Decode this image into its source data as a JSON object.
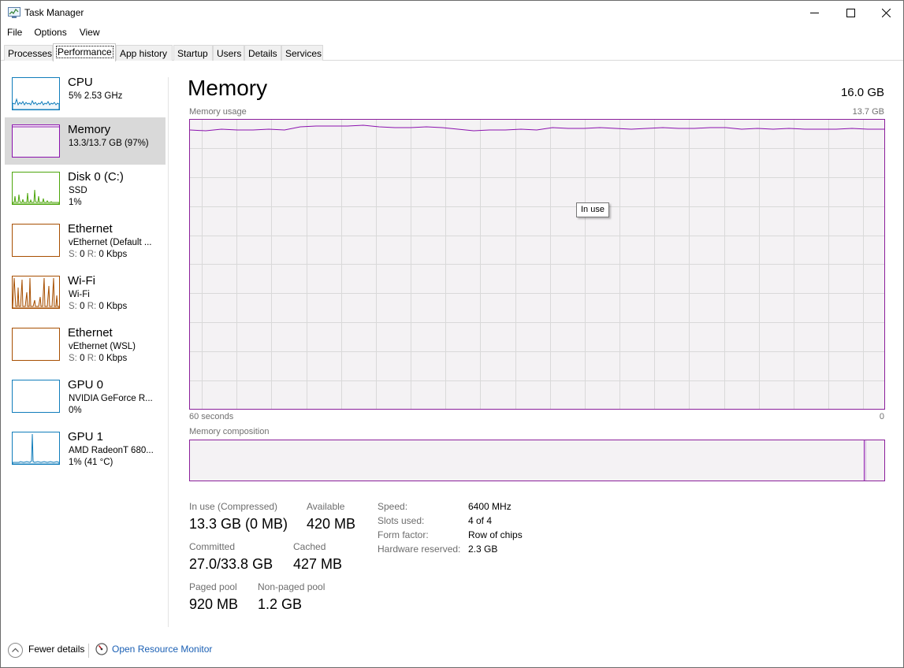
{
  "window": {
    "title": "Task Manager"
  },
  "menu": [
    "File",
    "Options",
    "View"
  ],
  "tabs": [
    "Processes",
    "Performance",
    "App history",
    "Startup",
    "Users",
    "Details",
    "Services"
  ],
  "active_tab": "Performance",
  "sidebar": {
    "items": [
      {
        "title": "CPU",
        "line1": "5%  2.53 GHz",
        "line2": "",
        "color": "#117dbb",
        "icon": "cpu-graph-icon"
      },
      {
        "title": "Memory",
        "line1": "13.3/13.7 GB (97%)",
        "line2": "",
        "color": "#8b12ae",
        "icon": "memory-graph-icon"
      },
      {
        "title": "Disk 0 (C:)",
        "line1": "SSD",
        "line2": "1%",
        "color": "#4da60c",
        "icon": "disk-graph-icon"
      },
      {
        "title": "Ethernet",
        "line1": "vEthernet (Default ...",
        "line2s": "S:",
        "line2sv": "0",
        "line2r": "R:",
        "line2rv": "0 Kbps",
        "color": "#a74f01",
        "icon": "ethernet-graph-icon"
      },
      {
        "title": "Wi-Fi",
        "line1": "Wi-Fi",
        "line2s": "S:",
        "line2sv": "0",
        "line2r": "R:",
        "line2rv": "0 Kbps",
        "color": "#a74f01",
        "icon": "wifi-graph-icon"
      },
      {
        "title": "Ethernet",
        "line1": "vEthernet (WSL)",
        "line2s": "S:",
        "line2sv": "0",
        "line2r": "R:",
        "line2rv": "0 Kbps",
        "color": "#a74f01",
        "icon": "ethernet-graph-icon"
      },
      {
        "title": "GPU 0",
        "line1": "NVIDIA GeForce R...",
        "line2": "0%",
        "color": "#117dbb",
        "icon": "gpu-graph-icon"
      },
      {
        "title": "GPU 1",
        "line1": "AMD RadeonT 680...",
        "line2": "1% (41 °C)",
        "color": "#117dbb",
        "icon": "gpu-graph-icon"
      }
    ],
    "active_index": 1
  },
  "main": {
    "title": "Memory",
    "total": "16.0 GB",
    "usage_label": "Memory usage",
    "usage_max": "13.7 GB",
    "time_left": "60 seconds",
    "time_right": "0",
    "tooltip": "In use",
    "composition_label": "Memory composition",
    "accent_color": "#8b12ae"
  },
  "stats": {
    "in_use_label": "In use (Compressed)",
    "in_use_value": "13.3 GB (0 MB)",
    "available_label": "Available",
    "available_value": "420 MB",
    "committed_label": "Committed",
    "committed_value": "27.0/33.8 GB",
    "cached_label": "Cached",
    "cached_value": "427 MB",
    "paged_label": "Paged pool",
    "paged_value": "920 MB",
    "nonpaged_label": "Non-paged pool",
    "nonpaged_value": "1.2 GB"
  },
  "specs": {
    "speed_label": "Speed:",
    "speed_value": "6400 MHz",
    "slots_label": "Slots used:",
    "slots_value": "4 of 4",
    "form_label": "Form factor:",
    "form_value": "Row of chips",
    "reserved_label": "Hardware reserved:",
    "reserved_value": "2.3 GB"
  },
  "footer": {
    "fewer_details": "Fewer details",
    "open_monitor": "Open Resource Monitor"
  }
}
